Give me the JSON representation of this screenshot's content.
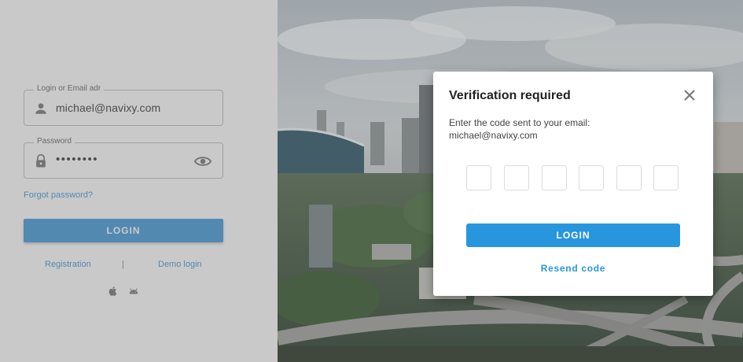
{
  "login_form": {
    "login_label": "Login or Email adr",
    "login_value": "michael@navixy.com",
    "password_label": "Password",
    "password_value": "••••••••",
    "forgot_password": "Forgot password?",
    "login_button": "LOGIN",
    "registration_link": "Registration",
    "separator": "|",
    "demo_login_link": "Demo login",
    "store_icons": [
      "apple-icon",
      "android-icon"
    ]
  },
  "modal": {
    "title": "Verification required",
    "instruction": "Enter the code sent to your email:",
    "email": "michael@navixy.com",
    "code_digits": [
      "",
      "",
      "",
      "",
      "",
      ""
    ],
    "login_button": "LOGIN",
    "resend_link": "Resend code"
  },
  "colors": {
    "accent": "#2896de",
    "link": "#2f8fd5",
    "overlay": "rgba(130,130,130,0.43)"
  }
}
